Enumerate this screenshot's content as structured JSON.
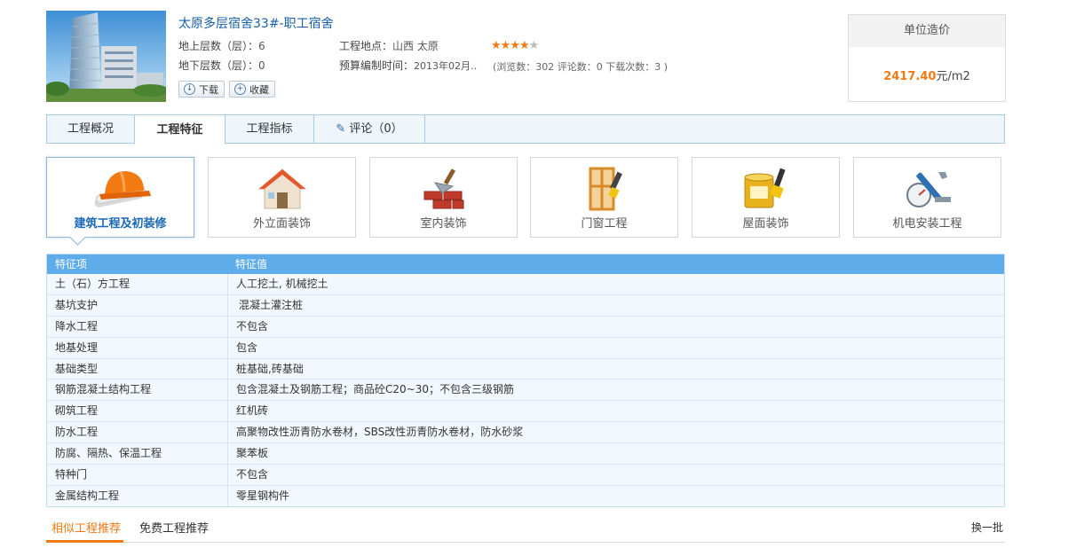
{
  "project": {
    "title": "太原多层宿舍33#-职工宿舍",
    "floors_above_label": "地上层数（层）：",
    "floors_above_value": "6",
    "floors_below_label": "地下层数（层）：",
    "floors_below_value": "0",
    "location_label": "工程地点：",
    "location_value": "山西 太原",
    "budget_time_label": "预算编制时间：",
    "budget_time_value": "2013年02月‥",
    "rating": 4,
    "rating_max": 5,
    "stats": "(浏览数：302 评论数：0 下载次数：3 )",
    "download_label": "下载",
    "favorite_label": "收藏"
  },
  "price": {
    "header": "单位造价",
    "value": "2417.40",
    "unit": "元/m2"
  },
  "tabs": [
    {
      "label": "工程概况",
      "active": false
    },
    {
      "label": "工程特征",
      "active": true
    },
    {
      "label": "工程指标",
      "active": false
    },
    {
      "label": "评论（0）",
      "active": false,
      "icon": "pencil-icon"
    }
  ],
  "categories": [
    {
      "label": "建筑工程及初装修",
      "icon": "hardhat-icon",
      "active": true
    },
    {
      "label": "外立面装饰",
      "icon": "house-icon",
      "active": false
    },
    {
      "label": "室内装饰",
      "icon": "trowel-bricks-icon",
      "active": false
    },
    {
      "label": "门窗工程",
      "icon": "window-brush-icon",
      "active": false
    },
    {
      "label": "屋面装饰",
      "icon": "paint-bucket-icon",
      "active": false
    },
    {
      "label": "机电安装工程",
      "icon": "wrench-gauge-icon",
      "active": false
    }
  ],
  "feature_table": {
    "col1": "特征项",
    "col2": "特征值",
    "rows": [
      {
        "item": "土（石）方工程",
        "value": "人工挖土, 机械挖土"
      },
      {
        "item": "基坑支护",
        "value": "混凝土灌注桩"
      },
      {
        "item": "降水工程",
        "value": "不包含"
      },
      {
        "item": "地基处理",
        "value": "包含"
      },
      {
        "item": "基础类型",
        "value": "桩基础,砖基础"
      },
      {
        "item": "钢筋混凝土结构工程",
        "value": "包含混凝土及钢筋工程；商品砼C20~30；不包含三级钢筋"
      },
      {
        "item": "砌筑工程",
        "value": "红机砖"
      },
      {
        "item": "防水工程",
        "value": "高聚物改性沥青防水卷材，SBS改性沥青防水卷材，防水砂浆"
      },
      {
        "item": "防腐、隔热、保温工程",
        "value": "聚苯板"
      },
      {
        "item": "特种门",
        "value": "不包含"
      },
      {
        "item": "金属结构工程",
        "value": "零星钢构件"
      }
    ]
  },
  "recommend": {
    "tab_similar": "相似工程推荐",
    "tab_free": "免费工程推荐",
    "refresh": "换一批"
  },
  "colors": {
    "accent": "#f07a14",
    "link": "#1a5fa8",
    "table_header": "#5eacea"
  }
}
